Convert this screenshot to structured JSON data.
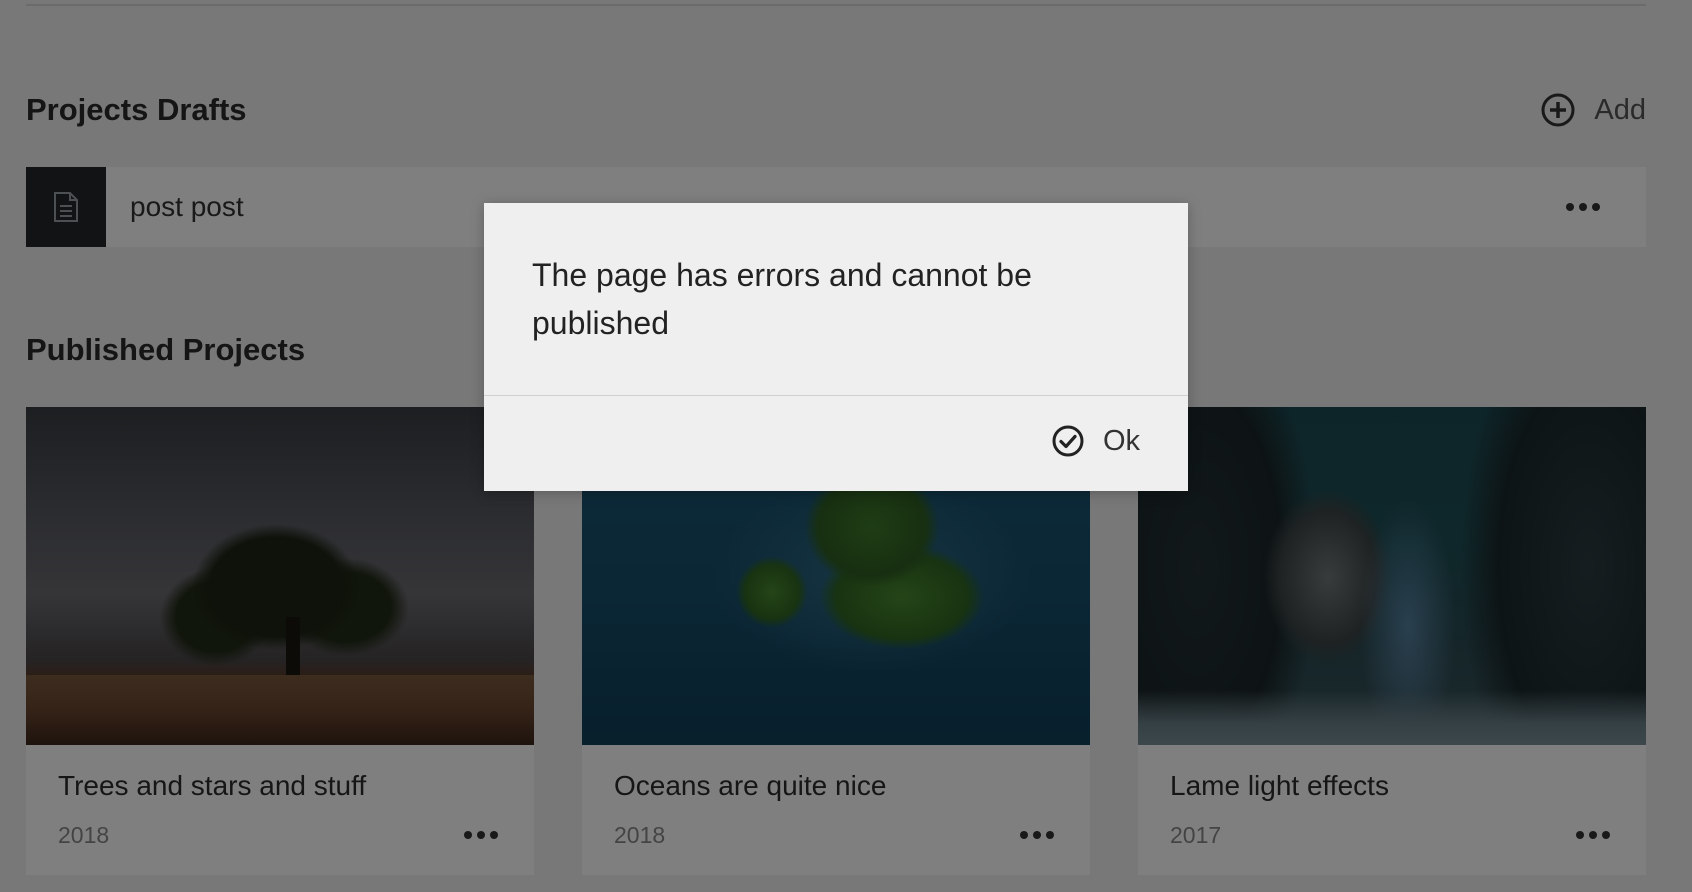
{
  "sections": {
    "drafts_title": "Projects Drafts",
    "add_label": "Add",
    "published_title": "Published Projects"
  },
  "drafts": [
    {
      "title": "post post",
      "icon": "document-icon"
    }
  ],
  "projects": [
    {
      "title": "Trees and stars and stuff",
      "year": "2018"
    },
    {
      "title": "Oceans are quite nice",
      "year": "2018"
    },
    {
      "title": "Lame light effects",
      "year": "2017"
    }
  ],
  "dialog": {
    "message": "The page has errors and cannot be published",
    "ok_label": "Ok"
  },
  "colors": {
    "background": "#f1f1f1",
    "card": "#ffffff",
    "draft_thumb": "#23262b",
    "dialog": "#efefef"
  }
}
